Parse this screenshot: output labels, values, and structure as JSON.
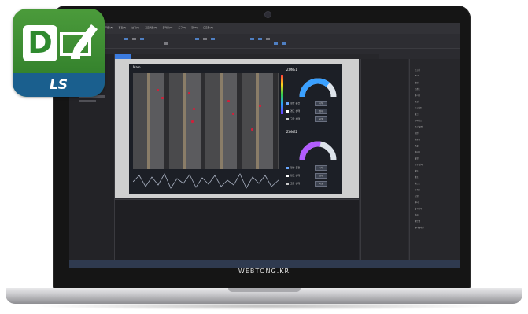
{
  "brand_text": "WEBTONG.KR",
  "logo": {
    "letter": "D",
    "company": "LS",
    "colors": {
      "green": "#3f8f36",
      "blue": "#1a5f8e"
    }
  },
  "app": {
    "menu_items": [
      "파일(F)",
      "편집(E)",
      "보기(V)",
      "프로젝트(P)",
      "온라인(O)",
      "도구(T)",
      "창(W)",
      "도움말(H)"
    ],
    "screen_title": "Main",
    "zones": [
      {
        "label": "ZONE1",
        "gauge_color": "#3aa0ff",
        "gauge_fraction": 0.72,
        "buttons": [
          "시작",
          "정지",
          "리셋"
        ]
      },
      {
        "label": "ZONE2",
        "gauge_color": "#b25cff",
        "gauge_fraction": 0.55,
        "buttons": [
          "시작",
          "정지",
          "리셋"
        ]
      }
    ],
    "legend": [
      "정상 운전",
      "경고 상태",
      "고장 상태"
    ],
    "right_tree": [
      "스크린",
      "Main",
      "알람",
      "트렌드",
      "레시피",
      "로깅",
      "스크립트",
      "태그",
      "디바이스",
      "통신 설정",
      "보안",
      "사용자",
      "글꼴",
      "이미지",
      "설정",
      "도구 상자",
      "버튼",
      "램프",
      "텍스트",
      "그래프",
      "도형",
      "미터",
      "슬라이더",
      "숫자",
      "비트맵",
      "애니메이션"
    ],
    "colors": {
      "accent": "#3b7be0",
      "status_bar": "#2f3a4f"
    }
  }
}
